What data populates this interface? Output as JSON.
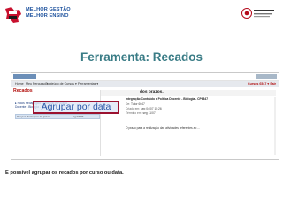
{
  "logo": {
    "line1": "MELHOR GESTÃO",
    "line2": "MELHOR ENSINO"
  },
  "slide": {
    "title": "Ferramenta: Recados"
  },
  "app": {
    "menu": [
      {
        "label": "Home"
      },
      {
        "label": "Meu Percurso ▾"
      },
      {
        "label": "Conteúdo de Cursos ▾"
      },
      {
        "label": "Ferramentas ▾"
      }
    ],
    "courses_label": "Cursos 6547 ▾ Sair",
    "page_label": "Recados",
    "tree": [
      "▸ Pólos Pedagógico Conteúdo e Política",
      "Docente - Biologia - CP6847"
    ],
    "selected_row": {
      "title": "Ver por Postagem de praca",
      "tag": "Ag 04/07"
    },
    "message": {
      "title": "dos prazos.",
      "course": "Integração Conteúdo e Política Docente - Biologia - CP6847",
      "author_label": "De:",
      "author": "Tutor 6047",
      "created_label": "Criado em:",
      "created": "seg 04/07 15:26",
      "ends_label": "Término em:",
      "ends": "seg 11/07",
      "body": "O prazo para a realização das atividades referentes ao ..."
    }
  },
  "callout": {
    "text": "Agrupar por data"
  },
  "caption": {
    "text": "É possível agrupar os recados por curso ou data."
  },
  "colors": {
    "title": "#3a7c86",
    "callout_border": "#9b1230",
    "callout_text": "#2b57a8",
    "page_label": "#b3120f"
  }
}
